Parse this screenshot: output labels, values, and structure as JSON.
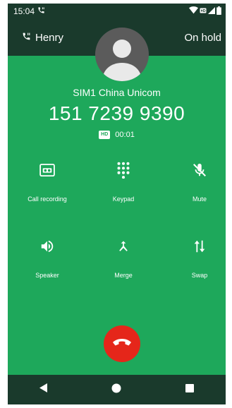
{
  "status_bar": {
    "time": "15:04"
  },
  "hold_bar": {
    "caller_name": "Henry",
    "status": "On hold"
  },
  "call": {
    "sim": "SIM1 China Unicom",
    "number": "151 7239 9390",
    "hd_badge": "HD",
    "duration": "00:01"
  },
  "actions": [
    {
      "label": "Call recording",
      "icon": "recording-icon"
    },
    {
      "label": "Keypad",
      "icon": "keypad-icon"
    },
    {
      "label": "Mute",
      "icon": "mute-icon"
    },
    {
      "label": "Speaker",
      "icon": "speaker-icon"
    },
    {
      "label": "Merge",
      "icon": "merge-icon"
    },
    {
      "label": "Swap",
      "icon": "swap-icon"
    }
  ],
  "colors": {
    "background": "#1ea85b",
    "bars": "#1a3a2c",
    "end_call": "#e5261a"
  }
}
